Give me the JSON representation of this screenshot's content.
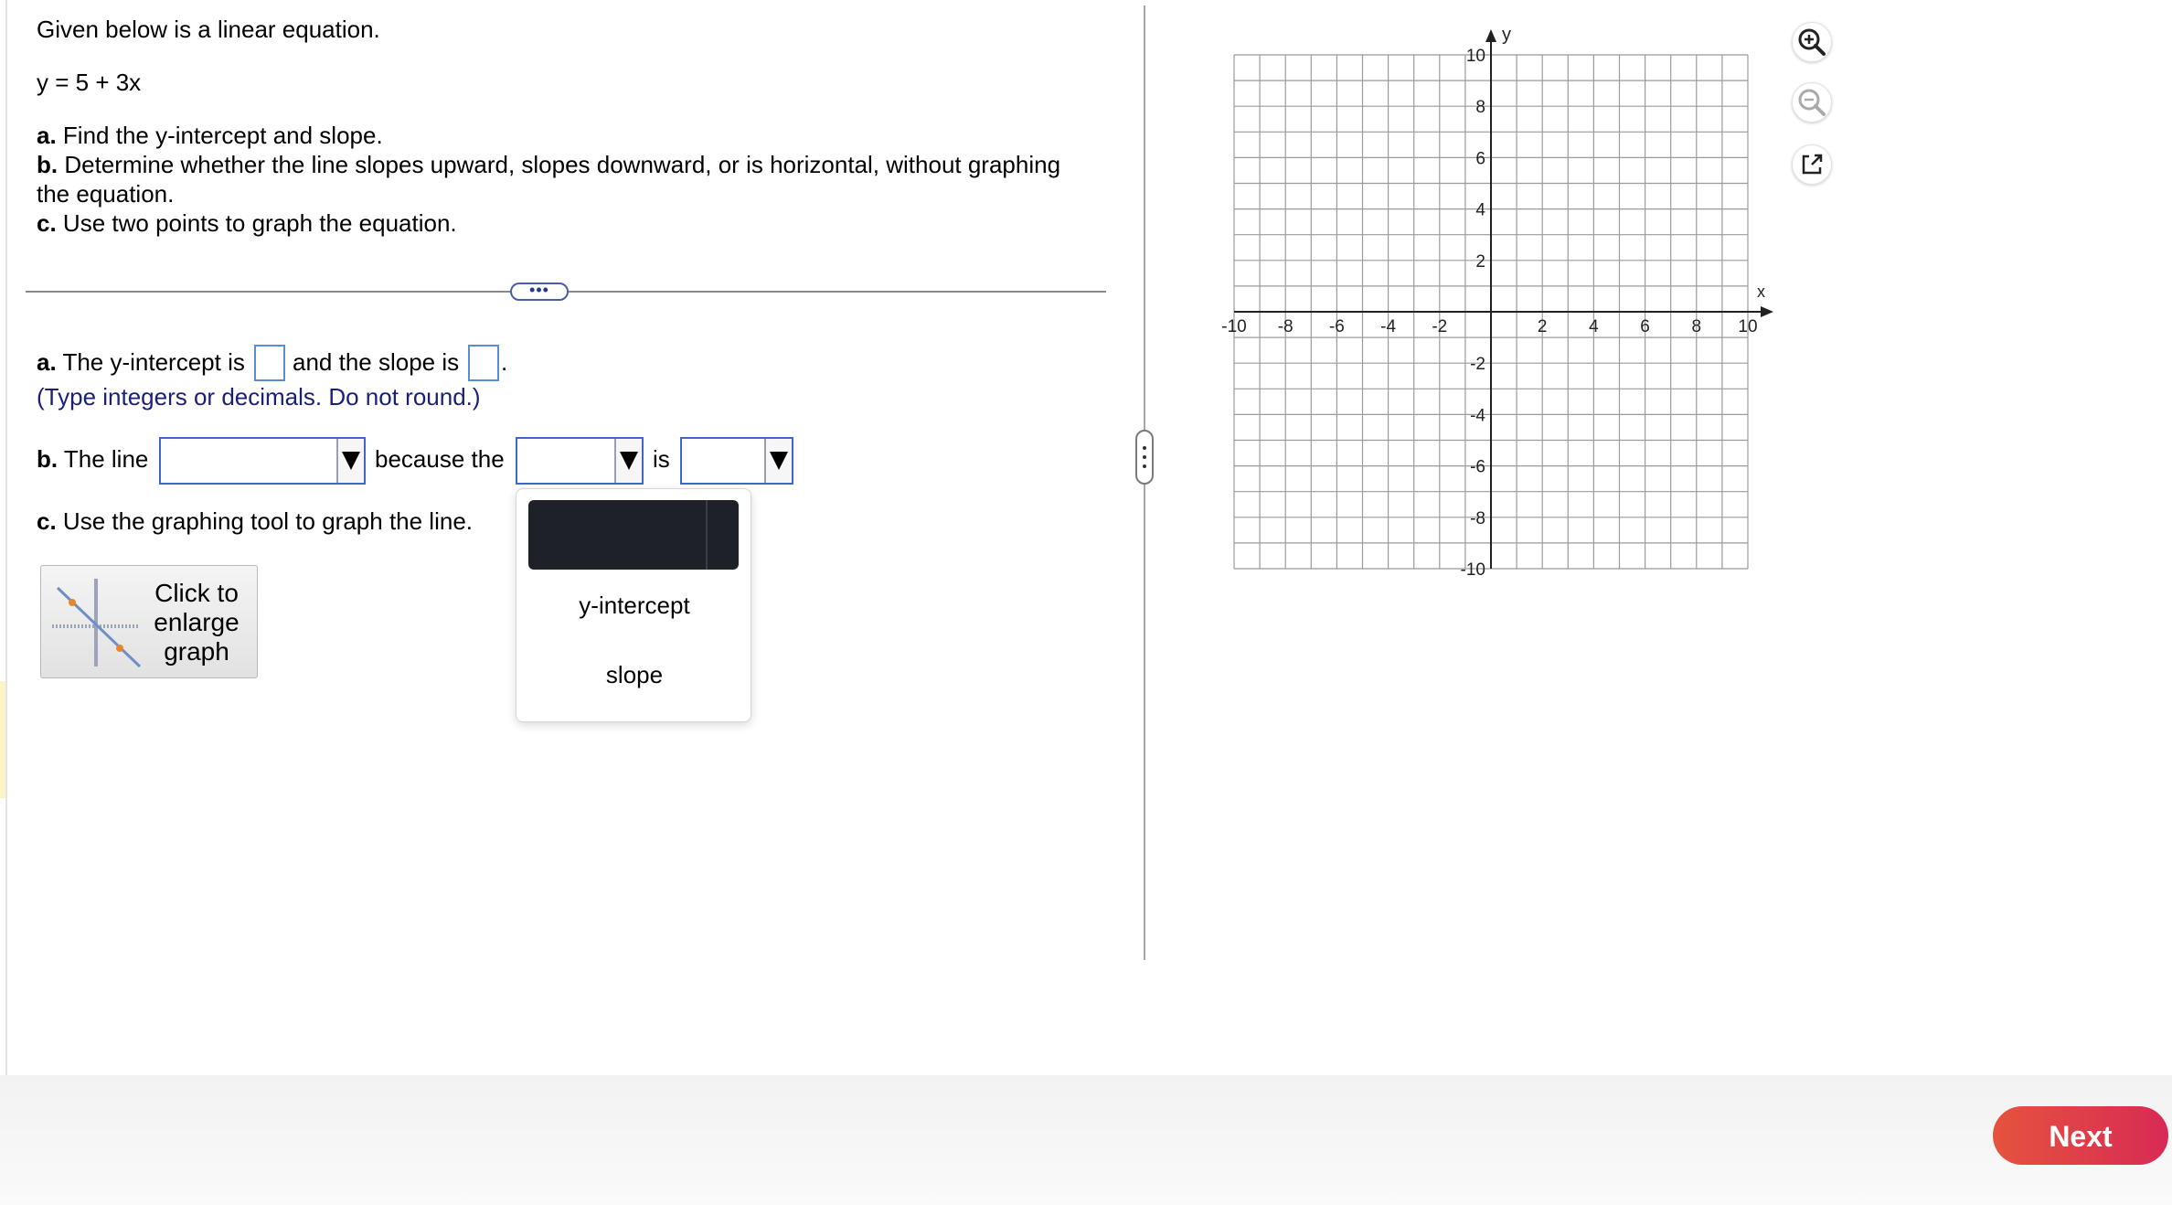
{
  "problem": {
    "intro": "Given below is a linear equation.",
    "equation": "y = 5 + 3x",
    "part_a_label": "a.",
    "part_a_text": "Find the y-intercept and slope.",
    "part_b_label": "b.",
    "part_b_text_line1": "Determine whether the line slopes upward, slopes downward, or is horizontal, without graphing",
    "part_b_text_line2": "the equation.",
    "part_c_label": "c.",
    "part_c_text": "Use two points to graph the equation."
  },
  "divider": {
    "handle_label": "•••"
  },
  "answer_a": {
    "label": "a.",
    "text_before": "The y-intercept is",
    "text_middle": "and the slope is",
    "text_end": ".",
    "hint": "(Type integers or decimals. Do not round.)",
    "yintercept_value": "",
    "slope_value": ""
  },
  "answer_b": {
    "label": "b.",
    "text_before": "The line",
    "text_because": "because the",
    "text_is": "is",
    "dropdown1_value": "",
    "dropdown2_value": "",
    "dropdown3_value": "",
    "open_menu_options": [
      "y-intercept",
      "slope"
    ]
  },
  "answer_c": {
    "label": "c.",
    "text": "Use the graphing tool to graph the line.",
    "enlarge_label_line1": "Click to",
    "enlarge_label_line2": "enlarge",
    "enlarge_label_line3": "graph"
  },
  "graph": {
    "x_axis_label": "x",
    "y_axis_label": "y",
    "x_range": [
      -10,
      10
    ],
    "y_range": [
      -10,
      10
    ],
    "grid_step": 1,
    "x_tick_labels": [
      "-10",
      "-8",
      "-6",
      "-4",
      "-2",
      "2",
      "4",
      "6",
      "8",
      "10"
    ],
    "y_tick_labels": [
      "10",
      "8",
      "6",
      "4",
      "2",
      "-2",
      "-4",
      "-6",
      "-8",
      "-10"
    ]
  },
  "tools": [
    "zoom-in-icon",
    "zoom-out-icon",
    "popout-icon"
  ],
  "footer": {
    "next_label": "Next"
  },
  "colors": {
    "next_button": "#e03a4c",
    "input_border": "#3f67c9",
    "hint_text": "#1a1f7a"
  }
}
